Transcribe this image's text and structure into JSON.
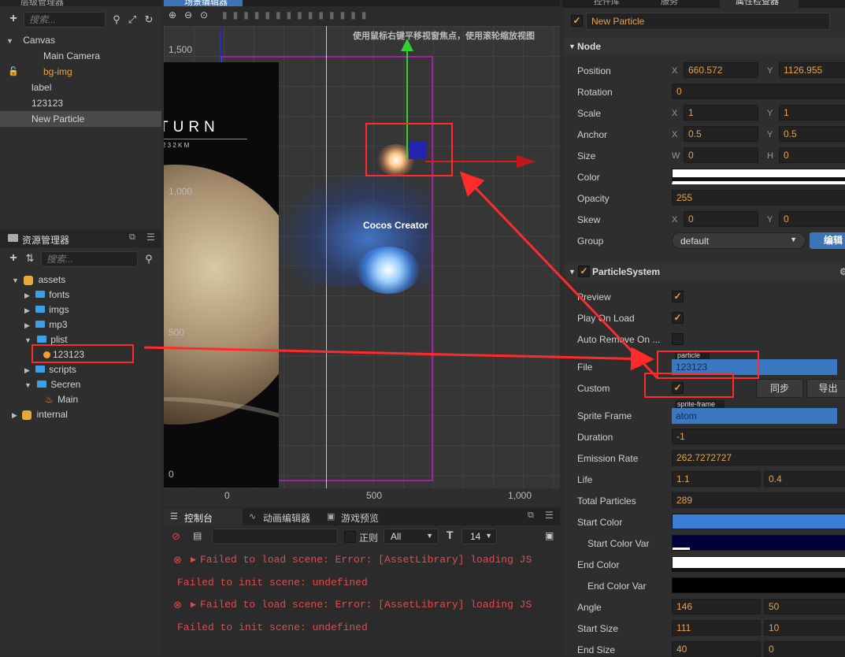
{
  "hierarchy": {
    "title": "层级管理器",
    "search_placeholder": "搜索...",
    "items": [
      "Canvas",
      "Main Camera",
      "bg-img",
      "label",
      "123123",
      "New Particle"
    ]
  },
  "assets": {
    "title": "资源管理器",
    "search_placeholder": "搜索...",
    "items": [
      "assets",
      "fonts",
      "imgs",
      "mp3",
      "plist",
      "123123",
      "scripts",
      "Secren",
      "Main",
      "internal"
    ]
  },
  "scene": {
    "title": "场景编辑器",
    "hint": "使用鼠标右键平移视窗焦点，使用滚轮缩放视图",
    "ruler_y": [
      "1,500",
      "1,000",
      "500",
      "0"
    ],
    "ruler_x": [
      "0",
      "500",
      "1,000"
    ],
    "poster_title": "TURN",
    "poster_sub": "2 3 2 K M",
    "cocos_label": "Cocos Creator"
  },
  "console": {
    "tabs": [
      "控制台",
      "动画编辑器",
      "游戏预览"
    ],
    "regex_label": "正则",
    "filter_value": "All",
    "font_size": "14",
    "lines": [
      "Failed to load scene: Error: [AssetLibrary] loading JS",
      "Failed to init scene: undefined",
      "Failed to load scene: Error: [AssetLibrary] loading JS",
      "Failed to init scene: undefined"
    ]
  },
  "inspector": {
    "tabs": [
      "控件库",
      "服务",
      "属性检查器"
    ],
    "node_name": "New Particle",
    "node_section": "Node",
    "position": {
      "x": "660.572",
      "y": "1126.955"
    },
    "rotation": "0",
    "scale": {
      "x": "1",
      "y": "1"
    },
    "anchor": {
      "x": "0.5",
      "y": "0.5"
    },
    "size": {
      "w": "0",
      "h": "0"
    },
    "opacity": "255",
    "skew": {
      "x": "0",
      "y": "0"
    },
    "group": "default",
    "edit_button": "编辑",
    "labels": {
      "position": "Position",
      "rotation": "Rotation",
      "scale": "Scale",
      "anchor": "Anchor",
      "size": "Size",
      "color": "Color",
      "opacity": "Opacity",
      "skew": "Skew",
      "group": "Group"
    },
    "axis": {
      "x": "X",
      "y": "Y",
      "w": "W",
      "h": "H"
    },
    "ps_section": "ParticleSystem",
    "ps_labels": {
      "preview": "Preview",
      "play_on_load": "Play On Load",
      "auto_remove": "Auto Remove On ...",
      "file": "File",
      "custom": "Custom",
      "sprite_frame": "Sprite Frame",
      "duration": "Duration",
      "emission_rate": "Emission Rate",
      "life": "Life",
      "total_particles": "Total Particles",
      "start_color": "Start Color",
      "start_color_var": "Start Color Var",
      "end_color": "End Color",
      "end_color_var": "End Color Var",
      "angle": "Angle",
      "start_size": "Start Size",
      "end_size": "End Size"
    },
    "file_tag": "particle",
    "file_value": "123123",
    "sync_button": "同步",
    "export_button": "导出",
    "sprite_tag": "sprite-frame",
    "sprite_value": "atom",
    "duration": "-1",
    "emission_rate": "262.7272727",
    "life": [
      "1.1",
      "0.4"
    ],
    "total_particles": "289",
    "angle": [
      "146",
      "50"
    ],
    "start_size": [
      "111",
      "10"
    ],
    "end_size": [
      "40",
      "0"
    ],
    "colors": {
      "accent": "#e9a14a",
      "start_color": "#3a7fd5",
      "start_color_var": "#00003a",
      "end_color": "#ffffff",
      "end_color_var": "#000000",
      "selection": "#3d74b5"
    }
  }
}
